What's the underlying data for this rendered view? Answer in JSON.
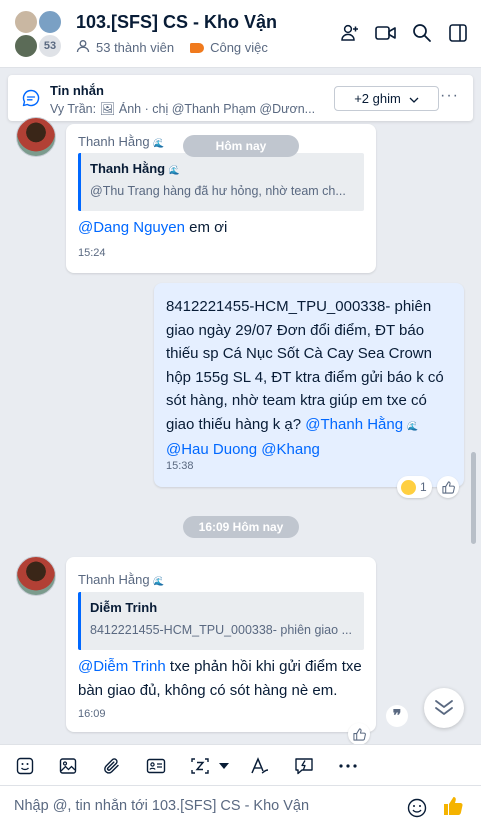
{
  "header": {
    "title": "103.[SFS] CS - Kho Vận",
    "avatar_count": "53",
    "members": "53 thành viên",
    "tag": "Công việc"
  },
  "pinned": {
    "title": "Tin nhắn",
    "preview": "Vy Trần: 🖼 Ảnh · chị @Thanh Phạm @Dươn...",
    "button": "+2 ghim",
    "more": "···"
  },
  "messages": [
    {
      "sender": "Thanh Hằng",
      "date_overlay": "Hôm nay",
      "quote_name": "Thanh Hằng",
      "quote_text": "@Thu Trang hàng đã hư hỏng, nhờ team ch...",
      "mention": "@Dang Nguyen",
      "text": " em ơi",
      "time": "15:24"
    },
    {
      "text_1": "8412221455-HCM_TPU_000338- phiên giao ngày 29/07 Đơn đổi điểm, ĐT báo thiếu sp Cá Nục Sốt Cà Cay Sea Crown hộp 155g SL 4, ĐT ktra điểm gửi báo k có sót hàng, nhờ team ktra giúp  em txe có giao thiếu hàng k ạ? ",
      "mention_1": "@Thanh Hằng",
      "mention_2": "@Hau Duong",
      "mention_3": "@Khang",
      "time": "15:38",
      "reaction_count": "1"
    },
    {
      "date_chip": "16:09 Hôm nay",
      "sender": "Thanh Hằng",
      "quote_name": "Diễm Trinh",
      "quote_text": "8412221455-HCM_TPU_000338- phiên giao ...",
      "mention": "@Diễm Trinh",
      "text": " txe phản hồi khi gửi điểm txe bàn giao đủ, không có sót hàng nè em.",
      "time": "16:09"
    }
  ],
  "composer": {
    "placeholder": "Nhập @, tin nhắn tới 103.[SFS] CS - Kho Vận"
  },
  "colors": {
    "accent": "#0068ff",
    "tag": "#f07a1d",
    "background": "#e9ecf1",
    "own_bubble": "#e5efff"
  },
  "icons": [
    "add-member-icon",
    "video-call-icon",
    "search-icon",
    "sidebar-toggle-icon",
    "chat-bubble-icon",
    "sticker-icon",
    "image-icon",
    "attachment-icon",
    "contact-card-icon",
    "screenshot-icon",
    "text-format-icon",
    "quick-message-icon",
    "more-icon",
    "emoji-icon",
    "thumbs-up-icon"
  ]
}
